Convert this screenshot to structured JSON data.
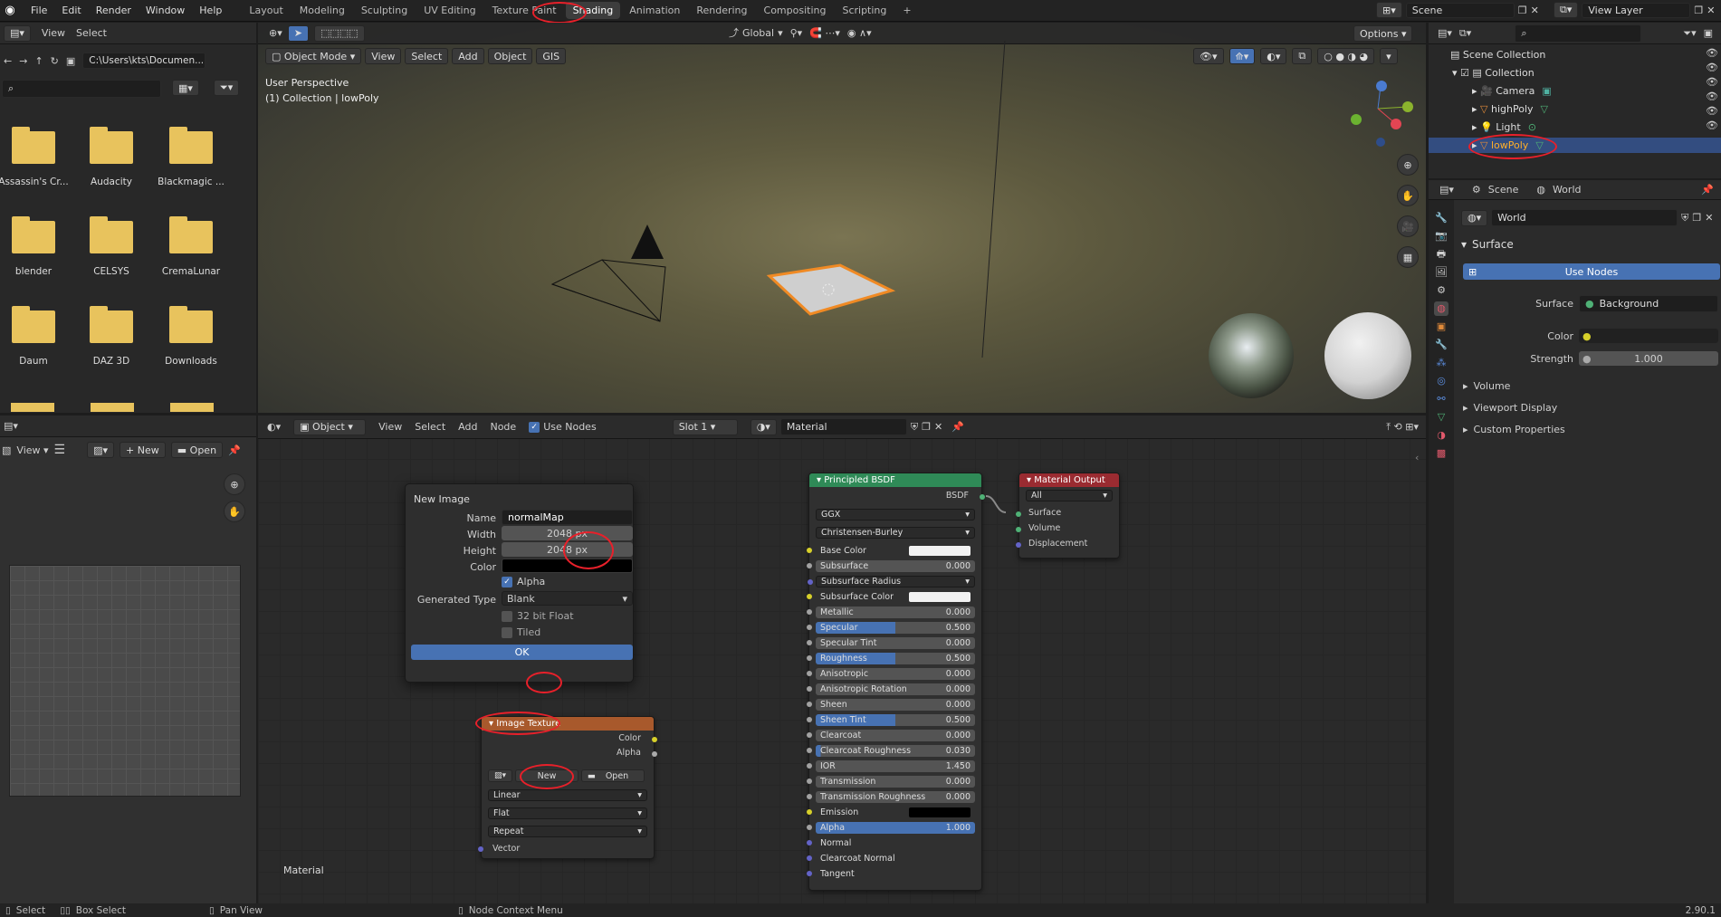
{
  "menu": {
    "file": "File",
    "edit": "Edit",
    "render": "Render",
    "window": "Window",
    "help": "Help"
  },
  "workspaces": [
    "Layout",
    "Modeling",
    "Sculpting",
    "UV Editing",
    "Texture Paint",
    "Shading",
    "Animation",
    "Rendering",
    "Compositing",
    "Scripting"
  ],
  "scene": {
    "scene_label": "Scene",
    "view_layer": "View Layer"
  },
  "file_browser": {
    "view": "View",
    "select": "Select",
    "path": "C:\\Users\\kts\\Documen...",
    "folders": [
      "Assassin's Cr...",
      "Audacity",
      "Blackmagic ...",
      "blender",
      "CELSYS",
      "CremaLunar",
      "Daum",
      "DAZ 3D",
      "Downloads"
    ]
  },
  "viewport": {
    "mode": "Object Mode",
    "view": "View",
    "select": "Select",
    "add": "Add",
    "object": "Object",
    "gis": "GIS",
    "transform": "Global",
    "options": "Options",
    "overlay_title": "User Perspective",
    "overlay_sub": "(1) Collection | lowPoly"
  },
  "outliner": {
    "scene_collection": "Scene Collection",
    "collection": "Collection",
    "items": [
      "Camera",
      "highPoly",
      "Light",
      "lowPoly"
    ]
  },
  "properties": {
    "scene_tab": "Scene",
    "world_tab": "World",
    "world_name": "World",
    "surface": "Surface",
    "use_nodes": "Use Nodes",
    "surface_label": "Surface",
    "surface_value": "Background",
    "color_label": "Color",
    "strength_label": "Strength",
    "strength_value": "1.000",
    "volume": "Volume",
    "viewport_display": "Viewport Display",
    "custom_properties": "Custom Properties"
  },
  "image_editor": {
    "view": "View",
    "new": "New",
    "open": "Open"
  },
  "node_editor": {
    "object": "Object",
    "view": "View",
    "select": "Select",
    "add": "Add",
    "node": "Node",
    "use_nodes": "Use Nodes",
    "slot": "Slot 1",
    "material": "Material",
    "bottom_label": "Material"
  },
  "new_image": {
    "title": "New Image",
    "name_label": "Name",
    "name_value": "normalMap",
    "width_label": "Width",
    "width_value": "2048 px",
    "height_label": "Height",
    "height_value": "2048 px",
    "color_label": "Color",
    "alpha_label": "Alpha",
    "gen_type_label": "Generated Type",
    "gen_type_value": "Blank",
    "float_label": "32 bit Float",
    "tiled_label": "Tiled",
    "ok": "OK"
  },
  "image_texture": {
    "title": "Image Texture",
    "color": "Color",
    "alpha": "Alpha",
    "new": "New",
    "open": "Open",
    "interp": "Linear",
    "proj": "Flat",
    "ext": "Repeat",
    "vector": "Vector"
  },
  "bsdf": {
    "title": "Principled BSDF",
    "out": "BSDF",
    "distribution": "GGX",
    "sss_method": "Christensen-Burley",
    "rows": [
      [
        "Base Color",
        ""
      ],
      [
        "Subsurface",
        "0.000"
      ],
      [
        "Subsurface Radius",
        ""
      ],
      [
        "Subsurface Color",
        ""
      ],
      [
        "Metallic",
        "0.000"
      ],
      [
        "Specular",
        "0.500"
      ],
      [
        "Specular Tint",
        "0.000"
      ],
      [
        "Roughness",
        "0.500"
      ],
      [
        "Anisotropic",
        "0.000"
      ],
      [
        "Anisotropic Rotation",
        "0.000"
      ],
      [
        "Sheen",
        "0.000"
      ],
      [
        "Sheen Tint",
        "0.500"
      ],
      [
        "Clearcoat",
        "0.000"
      ],
      [
        "Clearcoat Roughness",
        "0.030"
      ],
      [
        "IOR",
        "1.450"
      ],
      [
        "Transmission",
        "0.000"
      ],
      [
        "Transmission Roughness",
        "0.000"
      ],
      [
        "Emission",
        ""
      ],
      [
        "Alpha",
        "1.000"
      ],
      [
        "Normal",
        ""
      ],
      [
        "Clearcoat Normal",
        ""
      ],
      [
        "Tangent",
        ""
      ]
    ]
  },
  "material_output": {
    "title": "Material Output",
    "target": "All",
    "surface": "Surface",
    "volume": "Volume",
    "displacement": "Displacement"
  },
  "status": {
    "select": "Select",
    "box_select": "Box Select",
    "pan_view": "Pan View",
    "context_menu": "Node Context Menu",
    "version": "2.90.1"
  },
  "colors": {
    "accent": "#4772b3",
    "annotation": "#e8202a",
    "bsdf_header": "#2f8a57",
    "output_header": "#9a2b31",
    "tex_header": "#a8592c"
  }
}
